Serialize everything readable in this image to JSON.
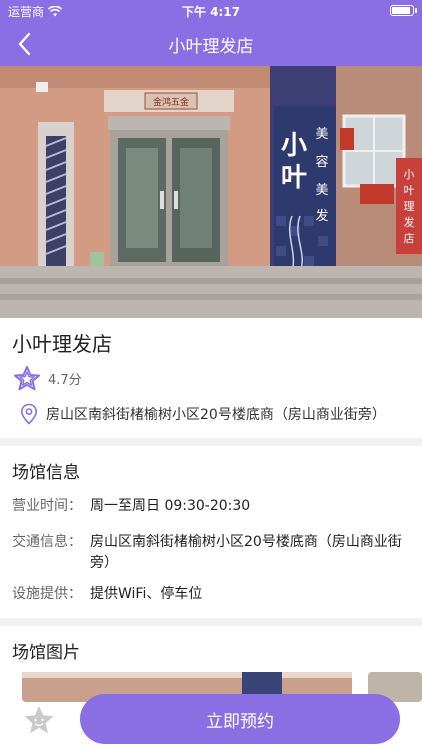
{
  "status_bar": {
    "carrier": "运营商",
    "time": "下午 4:17"
  },
  "nav": {
    "title": "小叶理发店"
  },
  "hero": {
    "sign_top": "金鸿五金",
    "sign_vertical_big": "小叶",
    "sign_vertical_small": "美容美发",
    "sign_right": "小叶理发店"
  },
  "shop": {
    "name": "小叶理发店",
    "rating": "4.7分",
    "address": "房山区南斜街楮榆树小区20号楼底商（房山商业街旁）"
  },
  "venue_info": {
    "title": "场馆信息",
    "rows": [
      {
        "label": "营业时间：",
        "value": "周一至周日 09:30-20:30"
      },
      {
        "label": "交通信息：",
        "value": "房山区南斜街楮榆树小区20号楼底商（房山商业街旁）"
      },
      {
        "label": "设施提供：",
        "value": "提供WiFi、停车位"
      }
    ]
  },
  "gallery": {
    "title": "场馆图片"
  },
  "actions": {
    "book_label": "立即预约"
  },
  "colors": {
    "accent": "#8a6fe4"
  }
}
